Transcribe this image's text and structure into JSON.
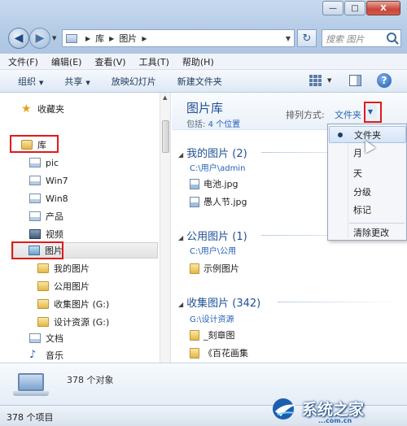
{
  "window": {
    "caption": {
      "minimize": "—",
      "maximize": "□",
      "close": "X"
    }
  },
  "address": {
    "seg1": "库",
    "seg2": "图片",
    "search_placeholder": "搜索 图片"
  },
  "menu": [
    "文件(F)",
    "编辑(E)",
    "查看(V)",
    "工具(T)",
    "帮助(H)"
  ],
  "toolbar": {
    "organize": "组织",
    "share": "共享",
    "slideshow": "放映幻灯片",
    "new_folder": "新建文件夹"
  },
  "nav": {
    "favorites": "收藏夹",
    "libraries": "库",
    "items": [
      "pic",
      "Win7",
      "Win8",
      "产品",
      "视频",
      "图片"
    ],
    "sub_items": [
      "我的图片",
      "公用图片",
      "收集图片 (G:)",
      "设计资源 (G:)"
    ],
    "bottom_items": [
      "文档",
      "音乐"
    ]
  },
  "library": {
    "title": "图片库",
    "includes_prefix": "包括:",
    "includes_link": "4 个位置",
    "sort_label": "排列方式:",
    "sort_value": "文件夹"
  },
  "groups": [
    {
      "title": "我的图片 (2)",
      "path": "C:\\用户\\admin",
      "files": [
        "电池.jpg",
        "愚人节.jpg"
      ]
    },
    {
      "title": "公用图片 (1)",
      "path": "C:\\用户\\公用",
      "files": [
        "示例图片"
      ]
    },
    {
      "title": "收集图片 (342)",
      "path": "G:\\设计资源",
      "files": [
        "_刻章图",
        "《百花画集"
      ]
    }
  ],
  "sort_menu": {
    "items": [
      "文件夹",
      "月",
      "天",
      "分级",
      "标记"
    ],
    "checked": "文件夹",
    "clear": "清除更改"
  },
  "details": {
    "count": "378 个对象"
  },
  "status": {
    "text": "378 个项目"
  },
  "watermark": {
    "text": "系统之家",
    "url": "...com.cn"
  }
}
